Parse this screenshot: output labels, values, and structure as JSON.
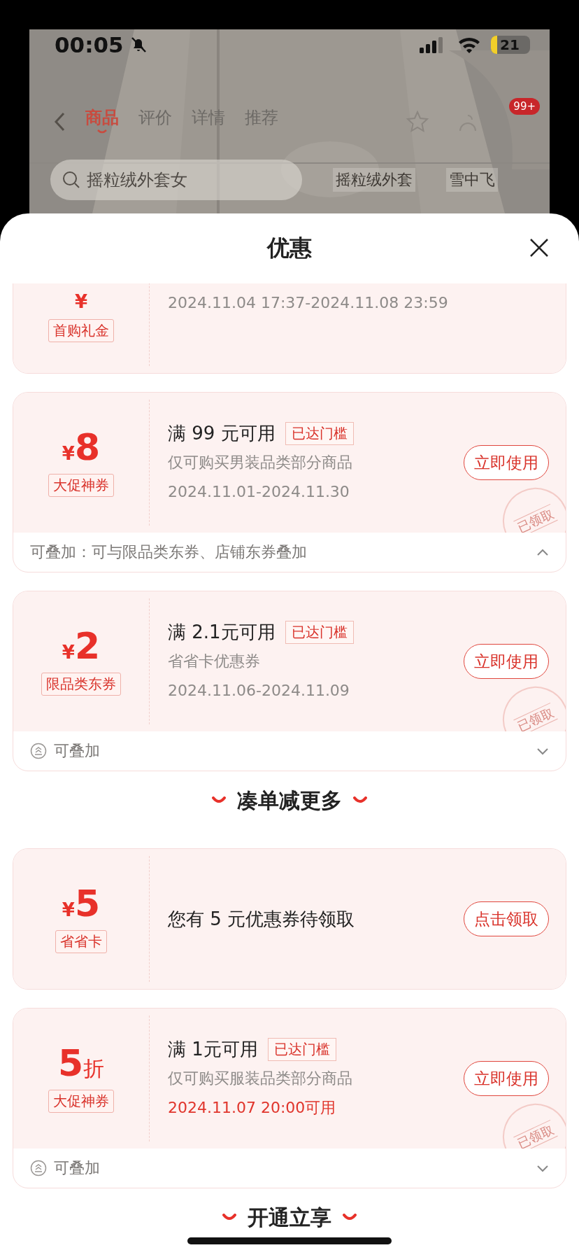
{
  "status_bar": {
    "time": "00:05",
    "battery": "21"
  },
  "background_page": {
    "kind": "picture",
    "tabs": [
      {
        "label": "商品",
        "selected": true
      },
      {
        "label": "评价",
        "selected": false
      },
      {
        "label": "详情",
        "selected": false
      },
      {
        "label": "推荐",
        "selected": false
      }
    ],
    "cart_badge": "99+",
    "search": {
      "placeholder": "摇粒绒外套女"
    },
    "suggestions": [
      "摇粒绒外套",
      "雪中飞"
    ]
  },
  "sheet": {
    "title": "优惠"
  },
  "coupons": [
    {
      "prefix": "¥",
      "tag": "首购礼金",
      "date": "2024.11.04 17:37-2024.11.08 23:59",
      "date_highlight": false
    },
    {
      "prefix": "¥",
      "amount": "8",
      "tag": "大促神券",
      "title": "满 99 元可用",
      "threshold_tag": "已达门槛",
      "description": "仅可购买男装品类部分商品",
      "date": "2024.11.01-2024.11.30",
      "date_highlight": false,
      "button": "立即使用",
      "stamp": "已领取",
      "footer": {
        "text": "可叠加：可与限品类东券、店铺东券叠加",
        "stack_icon": false,
        "expanded": true
      }
    },
    {
      "prefix": "¥",
      "amount": "2",
      "tag": "限品类东券",
      "title": "满 2.1元可用",
      "threshold_tag": "已达门槛",
      "description": "省省卡优惠券",
      "date": "2024.11.06-2024.11.09",
      "date_highlight": false,
      "button": "立即使用",
      "stamp": "已领取",
      "footer": {
        "text": "可叠加",
        "stack_icon": true,
        "expanded": false
      }
    }
  ],
  "section": {
    "title": "凑单减更多"
  },
  "more_coupons": [
    {
      "prefix": "¥",
      "amount": "5",
      "tag": "省省卡",
      "title": "您有 5 元优惠券待领取",
      "button": "点击领取"
    },
    {
      "amount": "5",
      "suffix": "折",
      "tag": "大促神券",
      "title": "满 1元可用",
      "threshold_tag": "已达门槛",
      "description": "仅可购买服装品类部分商品",
      "date": "2024.11.07 20:00可用",
      "date_highlight": true,
      "button": "立即使用",
      "stamp": "已领取",
      "footer": {
        "text": "可叠加",
        "stack_icon": true,
        "expanded": false
      }
    }
  ],
  "next_section": {
    "title": "开通立享"
  }
}
